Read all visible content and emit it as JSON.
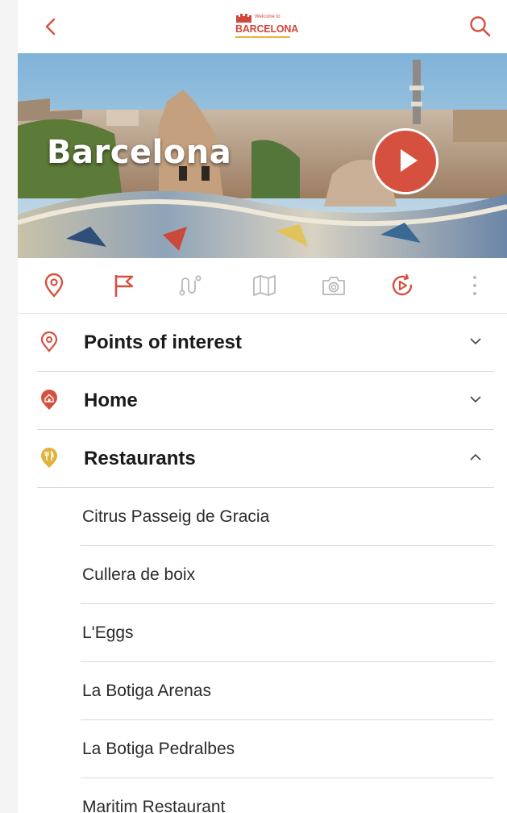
{
  "header": {
    "logo_small": "Welcome to",
    "logo_big": "BARCELONA",
    "back_icon": "chevron-left-icon",
    "search_icon": "search-icon"
  },
  "hero": {
    "title": "Barcelona",
    "play_icon": "play-icon"
  },
  "tabs": [
    {
      "icon": "location-pin-icon"
    },
    {
      "icon": "flag-icon"
    },
    {
      "icon": "route-icon"
    },
    {
      "icon": "map-icon"
    },
    {
      "icon": "camera-icon"
    },
    {
      "icon": "replay-video-icon"
    },
    {
      "icon": "more-vertical-icon"
    }
  ],
  "categories": [
    {
      "label": "Points of interest",
      "icon": "location-pin-icon",
      "expanded": false
    },
    {
      "label": "Home",
      "icon": "home-marker-icon",
      "expanded": false
    },
    {
      "label": "Restaurants",
      "icon": "restaurant-marker-icon",
      "expanded": true
    }
  ],
  "restaurants": [
    "Citrus Passeig de Gracia",
    "Cullera de boix",
    "L'Eggs",
    "La Botiga Arenas",
    "La Botiga Pedralbes",
    "Maritim Restaurant"
  ],
  "colors": {
    "accent": "#d6503f",
    "marker_red": "#d6503f",
    "marker_yellow": "#e0b23b",
    "divider": "#d9d9d9"
  }
}
